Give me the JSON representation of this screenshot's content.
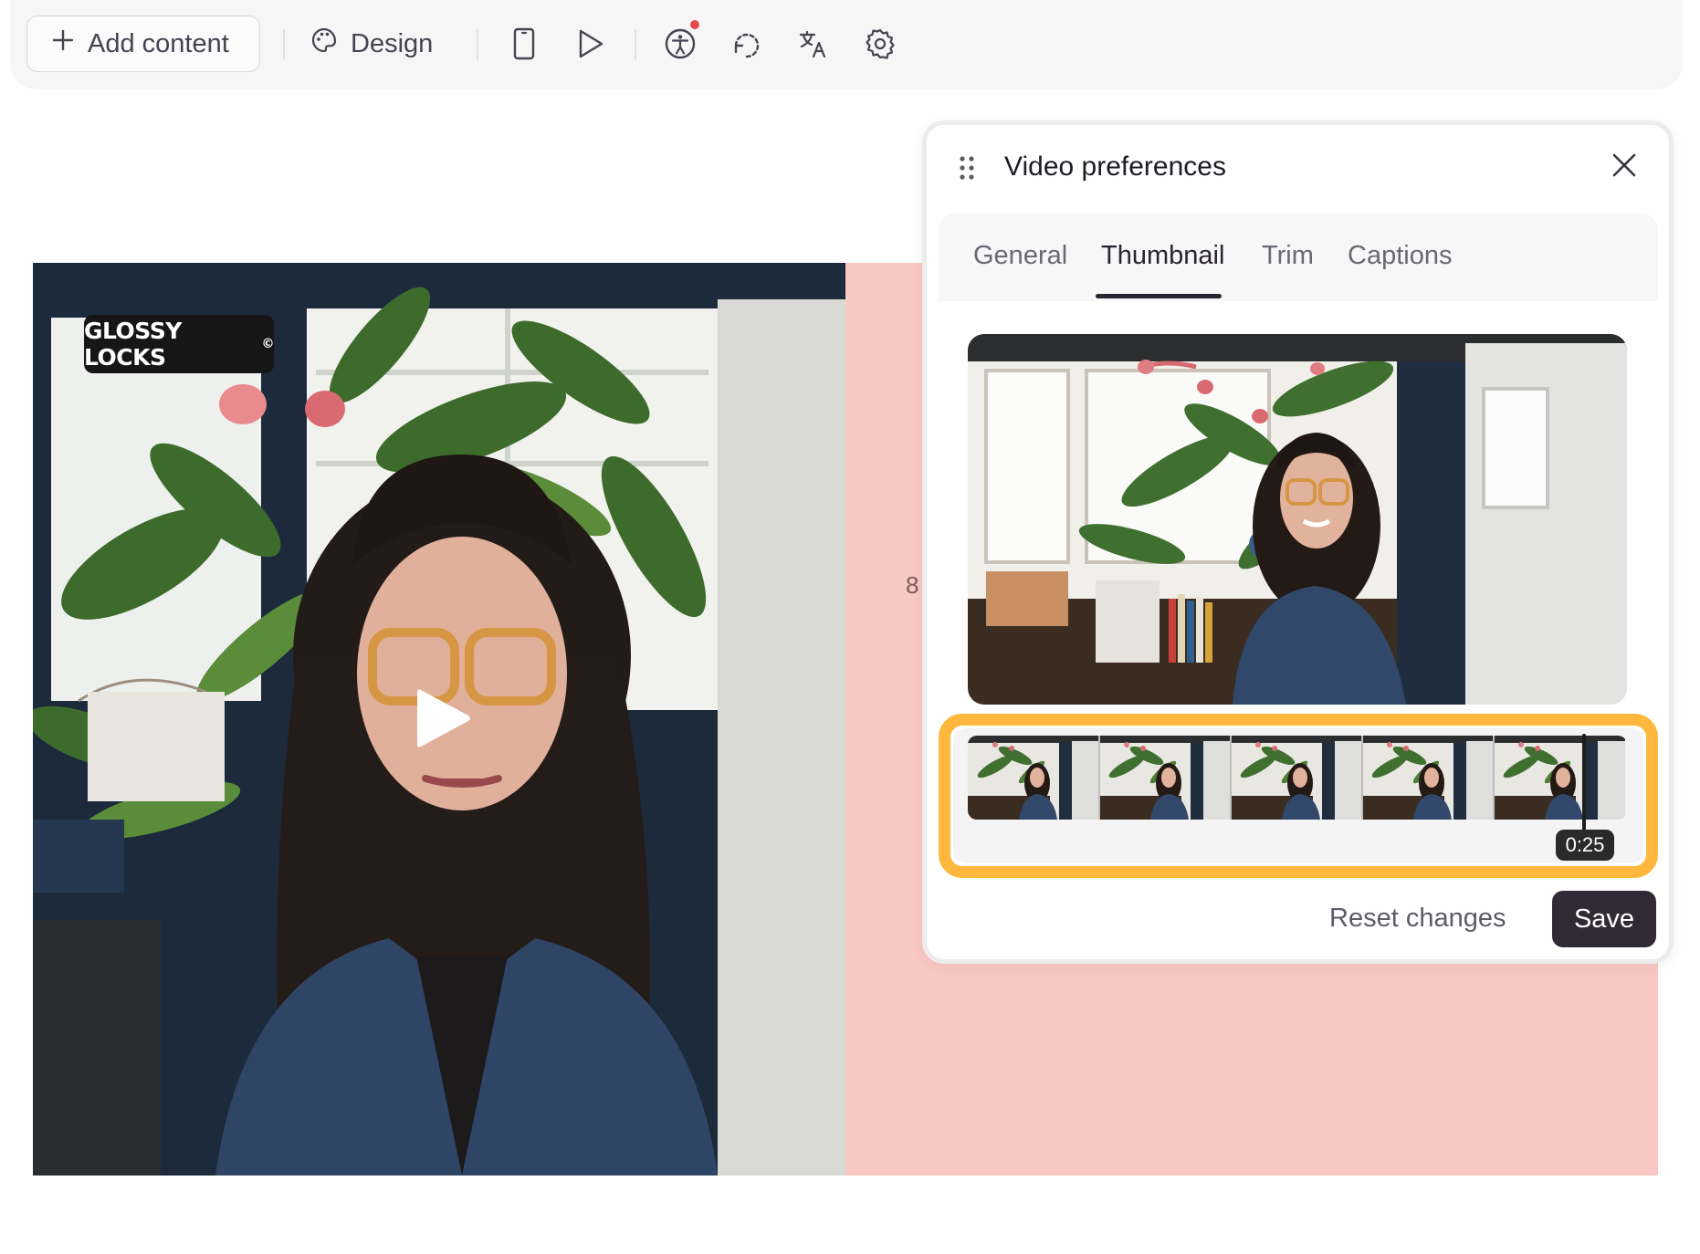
{
  "toolbar": {
    "add_content_label": "Add content",
    "design_label": "Design",
    "icons": [
      "plus-icon",
      "palette-icon",
      "mobile-preview-icon",
      "play-preview-icon",
      "accessibility-icon",
      "history-icon",
      "translate-icon",
      "settings-icon"
    ]
  },
  "canvas": {
    "brand_label": "GLOSSY LOCKS",
    "brand_mark": "©",
    "page_number": "8",
    "background_color": "#fac8c2"
  },
  "panel": {
    "title": "Video preferences",
    "tabs": [
      {
        "label": "General"
      },
      {
        "label": "Thumbnail"
      },
      {
        "label": "Trim"
      },
      {
        "label": "Captions"
      }
    ],
    "active_tab": "Thumbnail",
    "timestamp": "0:25",
    "reset_label": "Reset changes",
    "save_label": "Save",
    "highlight_color": "#ffb83d"
  }
}
